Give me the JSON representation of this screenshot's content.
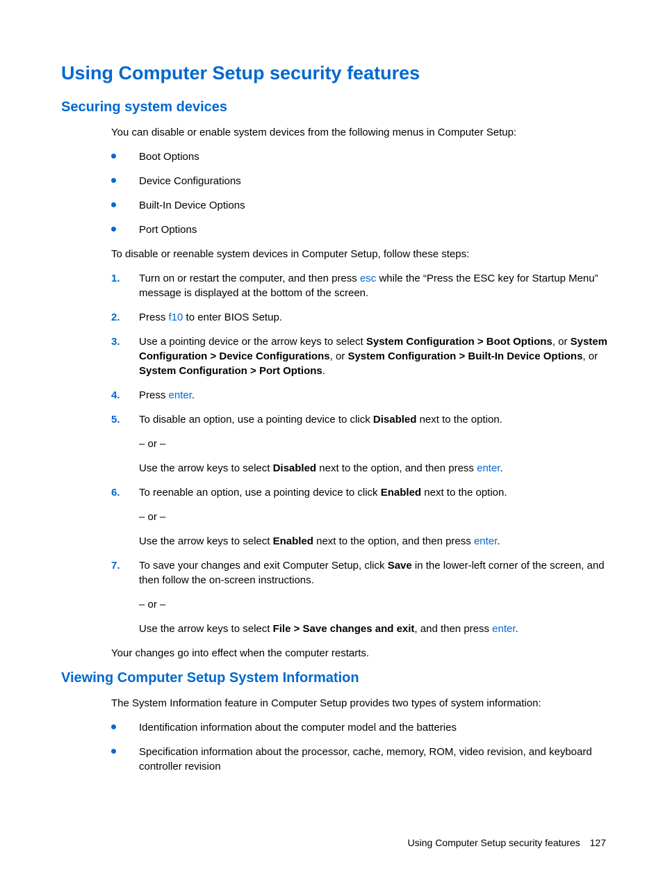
{
  "h1": "Using Computer Setup security features",
  "section1": {
    "title": "Securing system devices",
    "intro": "You can disable or enable system devices from the following menus in Computer Setup:",
    "bullets": [
      "Boot Options",
      "Device Configurations",
      "Built-In Device Options",
      "Port Options"
    ],
    "intro2": "To disable or reenable system devices in Computer Setup, follow these steps:",
    "steps": {
      "s1_a": "Turn on or restart the computer, and then press ",
      "s1_key": "esc",
      "s1_b": " while the “Press the ESC key for Startup Menu” message is displayed at the bottom of the screen.",
      "s2_a": "Press ",
      "s2_key": "f10",
      "s2_b": " to enter BIOS Setup.",
      "s3_a": "Use a pointing device or the arrow keys to select ",
      "s3_b1": "System Configuration > Boot Options",
      "s3_c1": ", or ",
      "s3_b2": "System Configuration > Device Configurations",
      "s3_c2": ", or ",
      "s3_b3": "System Configuration > Built-In Device Options",
      "s3_c3": ", or ",
      "s3_b4": "System Configuration > Port Options",
      "s3_c4": ".",
      "s4_a": "Press ",
      "s4_key": "enter",
      "s4_b": ".",
      "s5_a": "To disable an option, use a pointing device to click ",
      "s5_bold": "Disabled",
      "s5_b": " next to the option.",
      "or": "– or –",
      "s5_sub_a": "Use the arrow keys to select ",
      "s5_sub_bold": "Disabled",
      "s5_sub_b": " next to the option, and then press ",
      "s5_sub_key": "enter",
      "s5_sub_c": ".",
      "s6_a": "To reenable an option, use a pointing device to click ",
      "s6_bold": "Enabled",
      "s6_b": " next to the option.",
      "s6_sub_a": "Use the arrow keys to select ",
      "s6_sub_bold": "Enabled",
      "s6_sub_b": " next to the option, and then press ",
      "s6_sub_key": "enter",
      "s6_sub_c": ".",
      "s7_a": "To save your changes and exit Computer Setup, click ",
      "s7_bold": "Save",
      "s7_b": " in the lower-left corner of the screen, and then follow the on-screen instructions.",
      "s7_sub_a": "Use the arrow keys to select ",
      "s7_sub_bold": "File > Save changes and exit",
      "s7_sub_b": ", and then press ",
      "s7_sub_key": "enter",
      "s7_sub_c": "."
    },
    "outro": "Your changes go into effect when the computer restarts."
  },
  "section2": {
    "title": "Viewing Computer Setup System Information",
    "intro": "The System Information feature in Computer Setup provides two types of system information:",
    "bullets": [
      "Identification information about the computer model and the batteries",
      "Specification information about the processor, cache, memory, ROM, video revision, and keyboard controller revision"
    ]
  },
  "footer": {
    "text": "Using Computer Setup security features",
    "page": "127"
  }
}
